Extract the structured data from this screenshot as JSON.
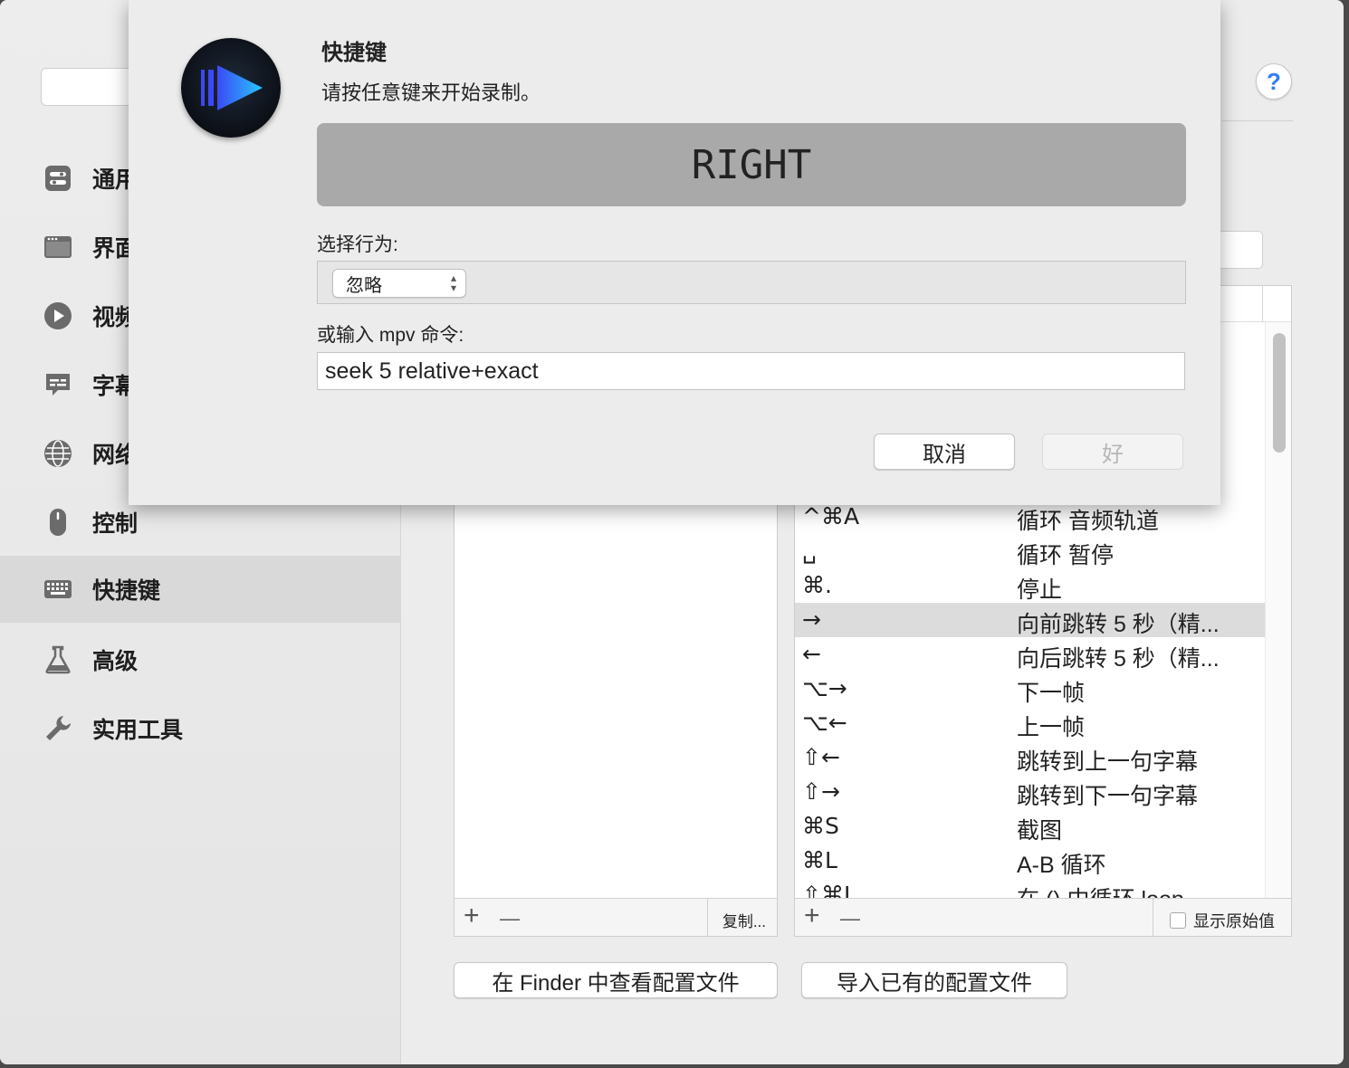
{
  "sidebar": {
    "items": [
      {
        "label": "通用",
        "icon": "toggle-icon"
      },
      {
        "label": "界面",
        "icon": "window-icon"
      },
      {
        "label": "视频",
        "icon": "play-icon"
      },
      {
        "label": "字幕",
        "icon": "speech-bubble-icon"
      },
      {
        "label": "网络",
        "icon": "globe-icon"
      },
      {
        "label": "控制",
        "icon": "mouse-icon"
      },
      {
        "label": "快捷键",
        "icon": "keyboard-icon"
      },
      {
        "label": "高级",
        "icon": "flask-icon"
      },
      {
        "label": "实用工具",
        "icon": "wrench-icon"
      }
    ],
    "selected": "快捷键"
  },
  "help_label": "?",
  "config_pane": {
    "add": "+",
    "remove": "—",
    "duplicate": "复制..."
  },
  "bindings": {
    "rows": [
      {
        "key": "^⌘A",
        "action": "循环 音频轨道"
      },
      {
        "key": "␣",
        "action": "循环 暂停"
      },
      {
        "key": "⌘.",
        "action": "停止"
      },
      {
        "key": "→",
        "action": "向前跳转 5 秒（精..."
      },
      {
        "key": "←",
        "action": "向后跳转 5 秒（精..."
      },
      {
        "key": "⌥→",
        "action": "下一帧"
      },
      {
        "key": "⌥←",
        "action": "上一帧"
      },
      {
        "key": "⇧←",
        "action": "跳转到上一句字幕"
      },
      {
        "key": "⇧→",
        "action": "跳转到下一句字幕"
      },
      {
        "key": "⌘S",
        "action": "截图"
      },
      {
        "key": "⌘L",
        "action": "A-B 循环"
      },
      {
        "key": "⇧⌘L",
        "action": "在 () 中循环 loop"
      }
    ],
    "selected_row": 3,
    "add": "+",
    "remove": "—",
    "show_raw_label": "显示原始值"
  },
  "buttons": {
    "reveal_in_finder": "在 Finder 中查看配置文件",
    "import_config": "导入已有的配置文件"
  },
  "sheet": {
    "title": "快捷键",
    "subtitle": "请按任意键来开始录制。",
    "recorded_key": "RIGHT",
    "action_label": "选择行为:",
    "action_value": "忽略",
    "command_label": "或输入 mpv 命令:",
    "command_value": "seek 5 relative+exact",
    "cancel": "取消",
    "ok": "好"
  }
}
